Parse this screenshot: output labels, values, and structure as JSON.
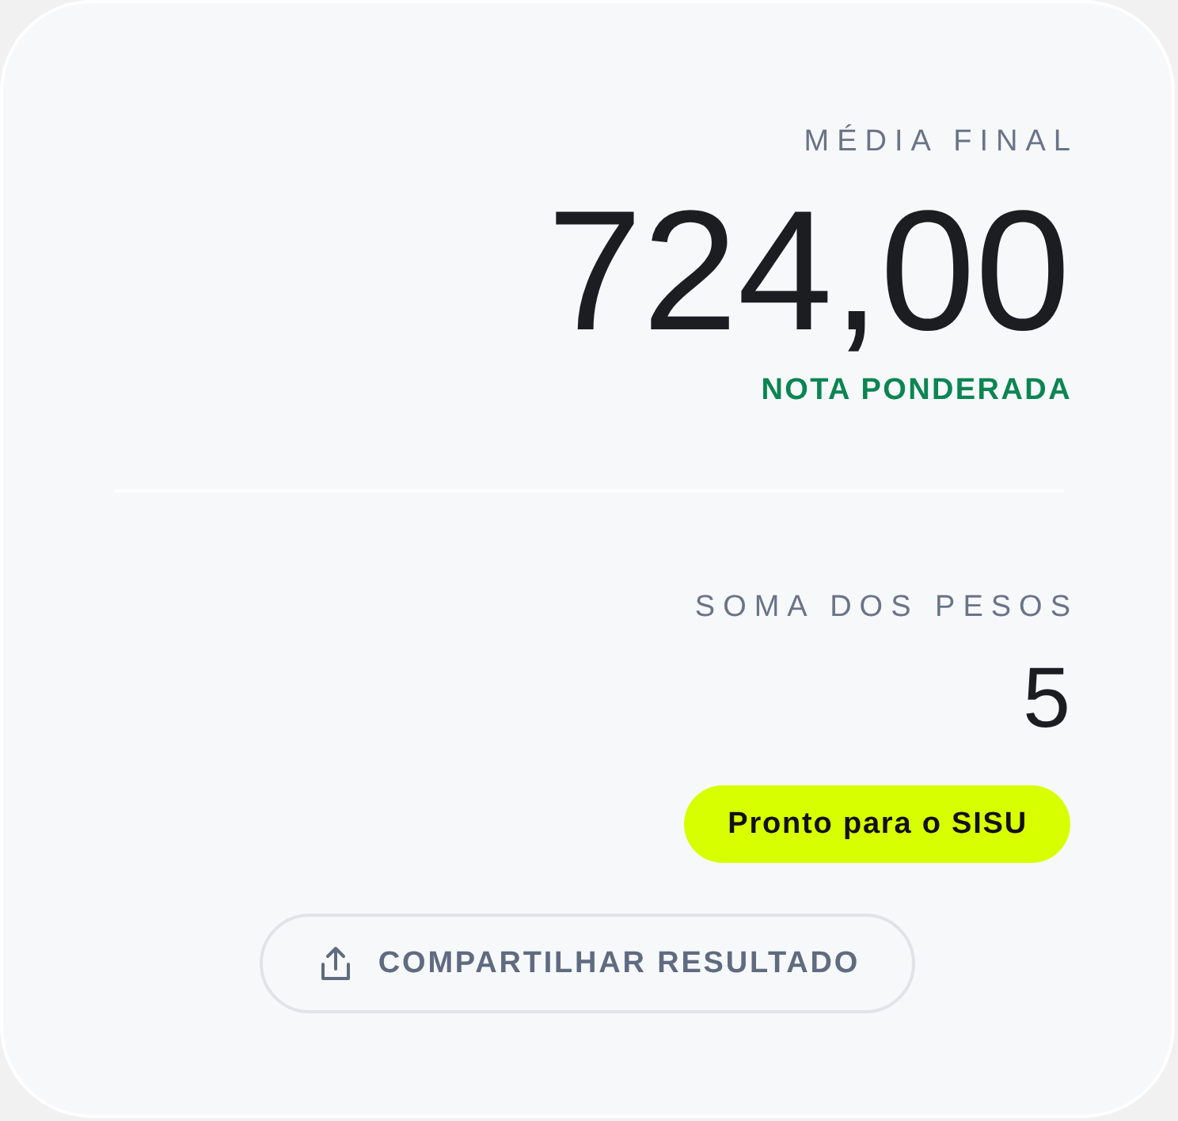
{
  "summary": {
    "label": "MÉDIA FINAL",
    "value": "724,00",
    "caption": "NOTA PONDERADA"
  },
  "weights": {
    "label": "SOMA DOS PESOS",
    "value": "5"
  },
  "status_badge": {
    "text": "Pronto para o SISU"
  },
  "share_button": {
    "label": "COMPARTILHAR RESULTADO"
  }
}
